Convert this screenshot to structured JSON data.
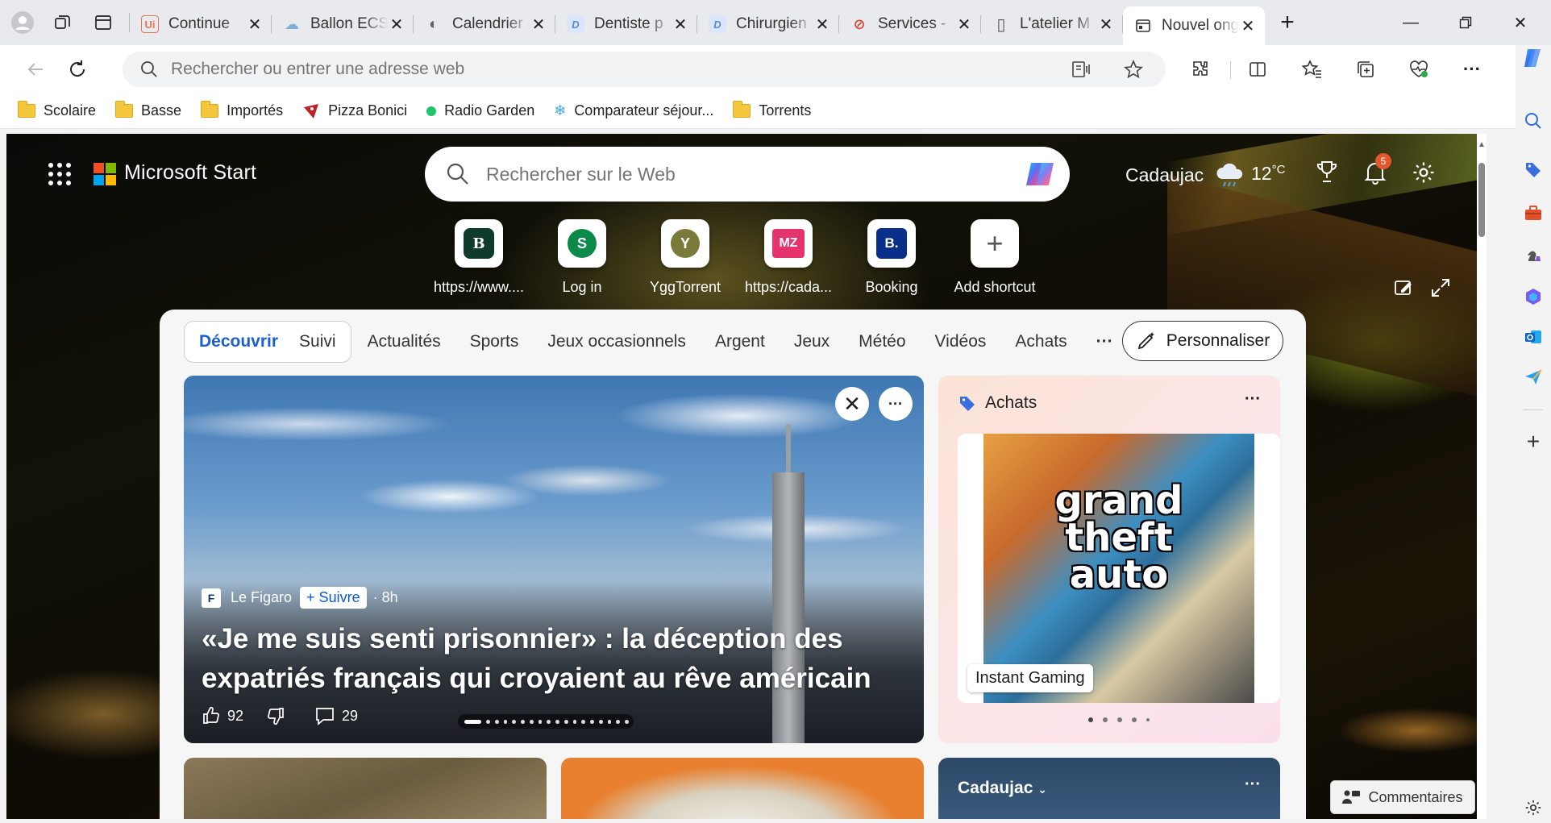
{
  "tabs": [
    {
      "title": "Continue",
      "fav_color": "#e8735a",
      "fav_letter": "Ui"
    },
    {
      "title": "Ballon ECS",
      "fav_color": "#7fb0d8",
      "fav_letter": "☁"
    },
    {
      "title": "Calendrier",
      "fav_color": "#666",
      "fav_letter": "◐"
    },
    {
      "title": "Dentiste p",
      "fav_color": "#5b8ad6",
      "fav_letter": "D"
    },
    {
      "title": "Chirurgien",
      "fav_color": "#5b8ad6",
      "fav_letter": "D"
    },
    {
      "title": "Services -",
      "fav_color": "#d64a3a",
      "fav_letter": "⊘"
    },
    {
      "title": "L'atelier M",
      "fav_color": "#555",
      "fav_letter": "▯"
    }
  ],
  "active_tab": {
    "title": "Nouvel onglet"
  },
  "address": {
    "placeholder": "Rechercher ou entrer une adresse web"
  },
  "bookmarks": [
    {
      "label": "Scolaire",
      "icon": "folder-icon"
    },
    {
      "label": "Basse",
      "icon": "folder-icon"
    },
    {
      "label": "Importés",
      "icon": "folder-icon"
    },
    {
      "label": "Pizza Bonici",
      "icon": "pizza-icon"
    },
    {
      "label": "Radio Garden",
      "icon": "radio-dot-icon"
    },
    {
      "label": "Comparateur séjour...",
      "icon": "snowflake-icon"
    },
    {
      "label": "Torrents",
      "icon": "folder-icon"
    }
  ],
  "header": {
    "brand": "Microsoft Start",
    "search_placeholder": "Rechercher sur le Web",
    "city": "Cadaujac",
    "temperature": "12",
    "temp_unit": "°C",
    "notif_count": "5"
  },
  "shortcuts": [
    {
      "label": "https://www....",
      "letter": "B",
      "color": "#0e3b2e"
    },
    {
      "label": "Log in",
      "letter": "S",
      "color": "#0b8a4a"
    },
    {
      "label": "YggTorrent",
      "letter": "Y",
      "color": "#7a7a3a"
    },
    {
      "label": "https://cada...",
      "letter": "MZ",
      "color": "#e5336b"
    },
    {
      "label": "Booking",
      "letter": "B.",
      "color": "#0a2f8a"
    },
    {
      "label": "Add shortcut",
      "letter": "+",
      "color": "#ffffff"
    }
  ],
  "feed": {
    "pill": [
      "Découvrir",
      "Suivi"
    ],
    "tabs": [
      "Actualités",
      "Sports",
      "Jeux occasionnels",
      "Argent",
      "Jeux",
      "Météo",
      "Vidéos",
      "Achats"
    ],
    "more": "···",
    "personalize": "Personnaliser"
  },
  "hero": {
    "source": "Le Figaro",
    "follow": "+ Suivre",
    "age": "· 8h",
    "headline": "«Je me suis senti prisonnier» : la déception des expatriés français qui croyaient au rêve américain",
    "likes": "92",
    "comments": "29",
    "close": "✕",
    "more": "···"
  },
  "shopping": {
    "title": "Achats",
    "more": "···",
    "product_text": "grand theft auto",
    "merchant": "Instant Gaming"
  },
  "weather_card": {
    "city": "Cadaujac",
    "more": "···"
  },
  "feedback": "Commentaires"
}
